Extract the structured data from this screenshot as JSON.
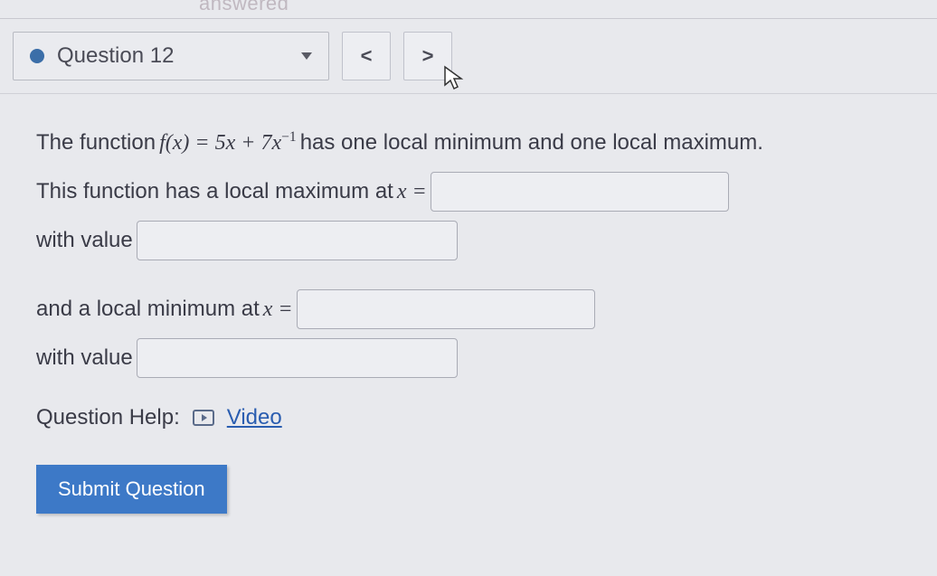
{
  "top_cutoff": "answered",
  "nav": {
    "question_label": "Question 12",
    "prev_symbol": "<",
    "next_symbol": ">"
  },
  "problem": {
    "intro_pre": "The function ",
    "func_lhs": "f(x) = 5x + 7x",
    "func_exp": "−1",
    "intro_post": " has one local minimum and one local maximum.",
    "line_max": "This function has a local maximum at ",
    "x_eq": "x =",
    "with_value": "with value",
    "line_min": "and a local minimum at "
  },
  "help": {
    "label": "Question Help:",
    "video": "Video"
  },
  "submit": "Submit Question"
}
